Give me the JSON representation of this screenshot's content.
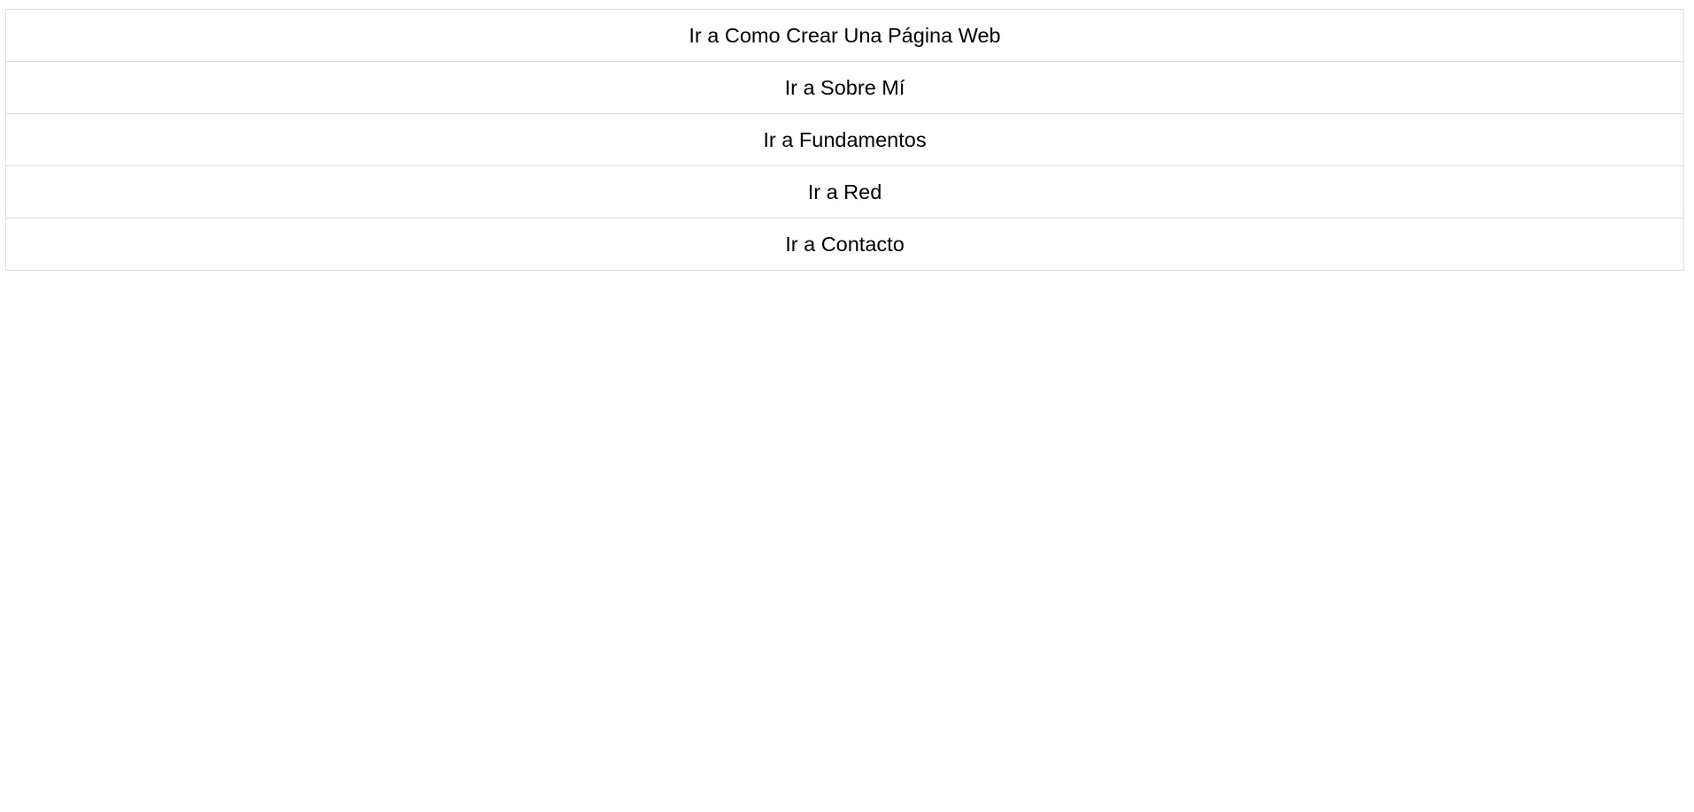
{
  "nav": {
    "items": [
      {
        "label": "Ir a Como Crear Una Página Web"
      },
      {
        "label": "Ir a Sobre Mí"
      },
      {
        "label": "Ir a Fundamentos"
      },
      {
        "label": "Ir a Red"
      },
      {
        "label": "Ir a Contacto"
      }
    ]
  }
}
